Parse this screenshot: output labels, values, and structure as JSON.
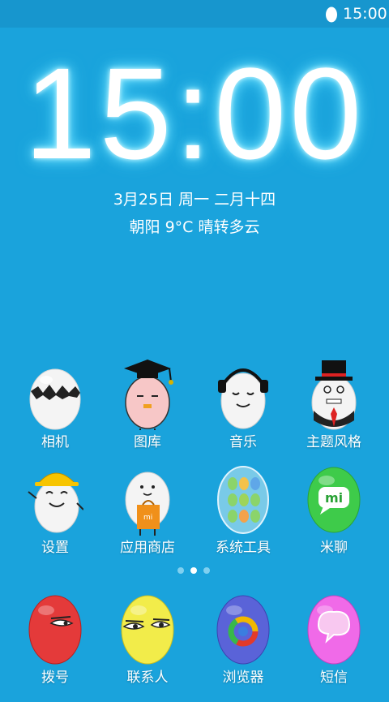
{
  "status_bar": {
    "time": "15:00",
    "icon": "egg-icon"
  },
  "clock": {
    "time": "15:00"
  },
  "date": {
    "text": "3月25日 周一 二月十四"
  },
  "weather": {
    "text": "朝阳 9°C 晴转多云"
  },
  "apps_row1": [
    {
      "label": "相机",
      "icon": "cracked-egg-camera-icon"
    },
    {
      "label": "图库",
      "icon": "graduate-egg-gallery-icon"
    },
    {
      "label": "音乐",
      "icon": "headphones-egg-music-icon"
    },
    {
      "label": "主题风格",
      "icon": "gentleman-egg-theme-icon"
    }
  ],
  "apps_row2": [
    {
      "label": "设置",
      "icon": "worker-egg-settings-icon"
    },
    {
      "label": "应用商店",
      "icon": "shopping-egg-store-icon"
    },
    {
      "label": "系统工具",
      "icon": "tools-folder-icon"
    },
    {
      "label": "米聊",
      "icon": "mitalk-egg-icon"
    }
  ],
  "page_indicator": {
    "count": 3,
    "active": 2
  },
  "dock": [
    {
      "label": "拨号",
      "icon": "red-egg-phone-icon"
    },
    {
      "label": "联系人",
      "icon": "yellow-egg-contacts-icon"
    },
    {
      "label": "浏览器",
      "icon": "blue-egg-browser-icon"
    },
    {
      "label": "短信",
      "icon": "pink-egg-sms-icon"
    }
  ],
  "colors": {
    "background": "#1aa3dc",
    "status_bar": "#1796ce"
  }
}
